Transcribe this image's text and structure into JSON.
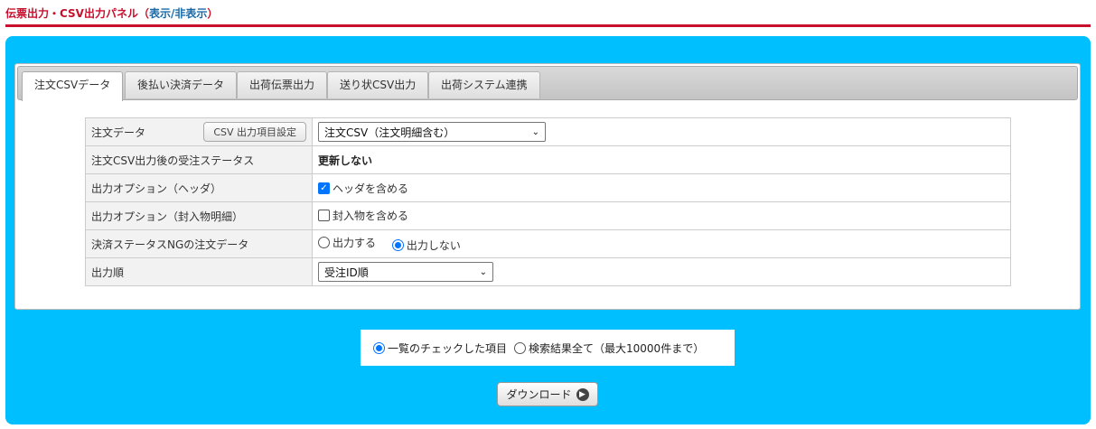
{
  "header": {
    "title": "伝票出力・CSV出力パネル",
    "paren_open": "（",
    "toggle_label": "表示/非表示",
    "paren_close": "）"
  },
  "tabs": [
    {
      "label": "注文CSVデータ",
      "active": true
    },
    {
      "label": "後払い決済データ",
      "active": false
    },
    {
      "label": "出荷伝票出力",
      "active": false
    },
    {
      "label": "送り状CSV出力",
      "active": false
    },
    {
      "label": "出荷システム連携",
      "active": false
    }
  ],
  "options": {
    "order_data": {
      "label": "注文データ",
      "settings_button": "CSV 出力項目設定",
      "select_value": "注文CSV（注文明細含む）"
    },
    "status_after": {
      "label": "注文CSV出力後の受注ステータス",
      "value": "更新しない"
    },
    "header_opt": {
      "label": "出力オプション（ヘッダ）",
      "checkbox_label": "ヘッダを含める",
      "checked": true
    },
    "enclosure_opt": {
      "label": "出力オプション（封入物明細）",
      "checkbox_label": "封入物を含める",
      "checked": false
    },
    "payment_ng": {
      "label": "決済ステータスNGの注文データ",
      "option_output": "出力する",
      "option_no_output": "出力しない",
      "selected": "出力しない"
    },
    "order_sort": {
      "label": "出力順",
      "select_value": "受注ID順"
    }
  },
  "scope": {
    "option_checked": "一覧のチェックした項目",
    "option_all": "検索結果全て（最大10000件まで）",
    "selected": "一覧のチェックした項目"
  },
  "download": {
    "label": "ダウンロード",
    "icon": "arrow-right-circle-icon"
  },
  "colors": {
    "accent_red": "#c8102e",
    "panel_blue": "#00bfff",
    "check_blue": "#0075ff"
  }
}
